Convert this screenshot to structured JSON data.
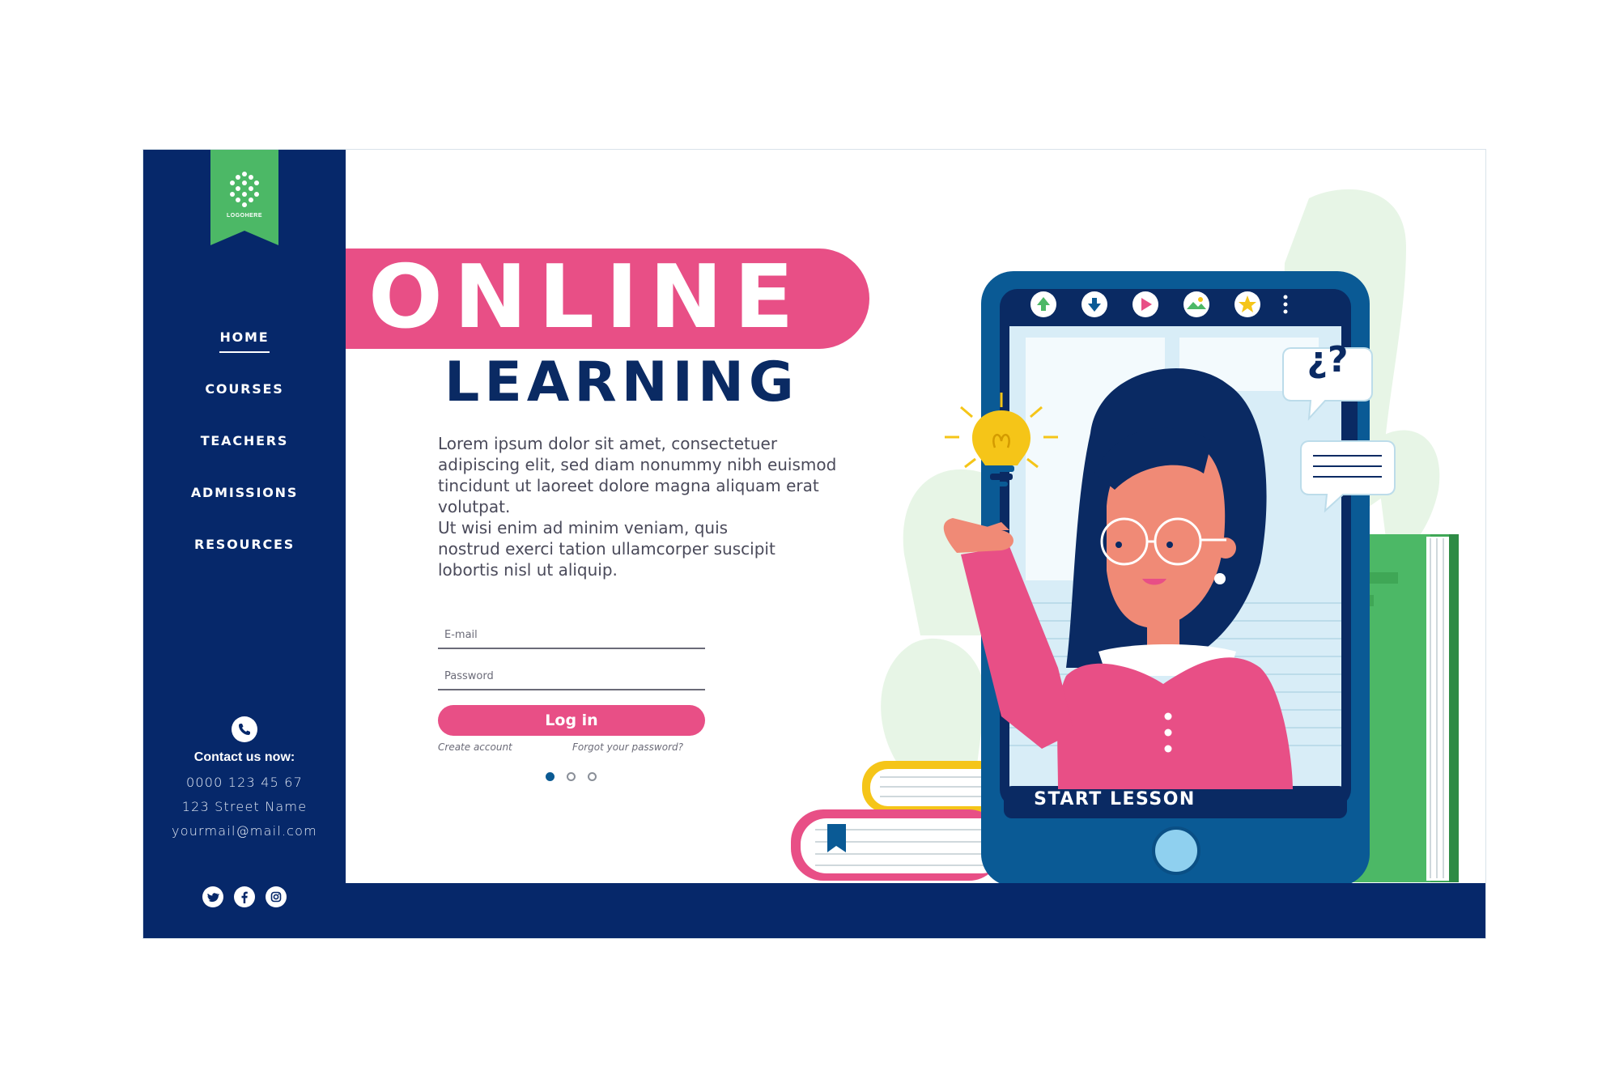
{
  "brand": {
    "logo_text": "LOGOHERE"
  },
  "nav": {
    "items": [
      {
        "label": "HOME",
        "active": true
      },
      {
        "label": "COURSES",
        "active": false
      },
      {
        "label": "TEACHERS",
        "active": false
      },
      {
        "label": "ADMISSIONS",
        "active": false
      },
      {
        "label": "RESOURCES",
        "active": false
      }
    ]
  },
  "contact": {
    "title": "Contact us now:",
    "phone": "0000 123 45 67",
    "address": "123 Street Name",
    "email": "yourmail@mail.com"
  },
  "social": [
    "twitter-icon",
    "facebook-icon",
    "instagram-icon"
  ],
  "hero": {
    "title_line1": "ONLINE",
    "title_line2": "LEARNING",
    "paragraph1": "Lorem ipsum dolor sit amet, consectetuer adipiscing elit, sed diam nonummy nibh euismod tincidunt ut laoreet dolore magna aliquam erat volutpat.",
    "paragraph2": "Ut wisi enim ad minim veniam, quis nostrud exerci tation ullamcorper suscipit lobortis nisl ut aliquip."
  },
  "login": {
    "email_placeholder": "E-mail",
    "password_placeholder": "Password",
    "button_label": "Log in",
    "create_account": "Create account",
    "forgot_password": "Forgot your password?"
  },
  "carousel": {
    "pages": 3,
    "active": 1
  },
  "illustration": {
    "start_lesson": "START LESSON",
    "speech_bubble": "¿?"
  },
  "colors": {
    "navy": "#06286a",
    "pink": "#e84f86",
    "green": "#4caf50",
    "tablet_blue": "#0a5a95"
  }
}
